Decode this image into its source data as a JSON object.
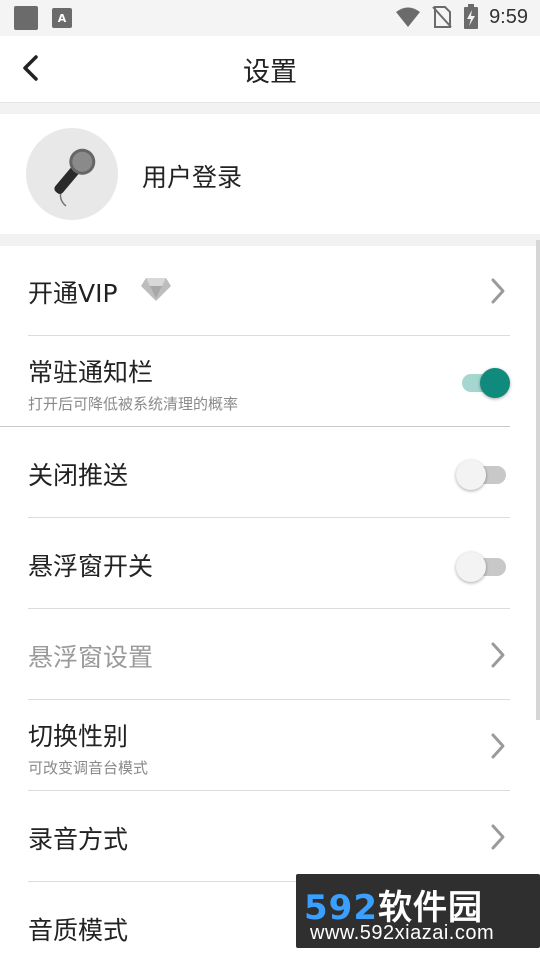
{
  "status_bar": {
    "time": "9:59",
    "notification_letter": "A",
    "icons": [
      "app-square-icon",
      "a-notification-icon",
      "wifi-icon",
      "no-sim-icon",
      "battery-charging-icon"
    ]
  },
  "header": {
    "title": "设置",
    "back_icon": "chevron-left-icon"
  },
  "user": {
    "label": "用户登录",
    "avatar_icon": "microphone-icon"
  },
  "settings": [
    {
      "label": "开通VIP",
      "control": "chevron",
      "badge_icon": "diamond-icon"
    },
    {
      "label": "常驻通知栏",
      "sub": "打开后可降低被系统清理的概率",
      "control": "toggle",
      "on": true
    },
    {
      "label": "关闭推送",
      "control": "toggle",
      "on": false
    },
    {
      "label": "悬浮窗开关",
      "control": "toggle",
      "on": false
    },
    {
      "label": "悬浮窗设置",
      "control": "chevron",
      "disabled": true
    },
    {
      "label": "切换性别",
      "sub": "可改变调音台模式",
      "control": "chevron"
    },
    {
      "label": "录音方式",
      "control": "chevron"
    },
    {
      "label": "音质模式",
      "control": "chevron"
    }
  ],
  "watermark": {
    "num": "592",
    "title": "软件园",
    "url": "www.592xiazai.com"
  },
  "colors": {
    "accent": "#0f8a7c",
    "accent_track": "#a5d6d0",
    "divider": "#dcdcdc",
    "section_gap": "#f2f2f2"
  }
}
